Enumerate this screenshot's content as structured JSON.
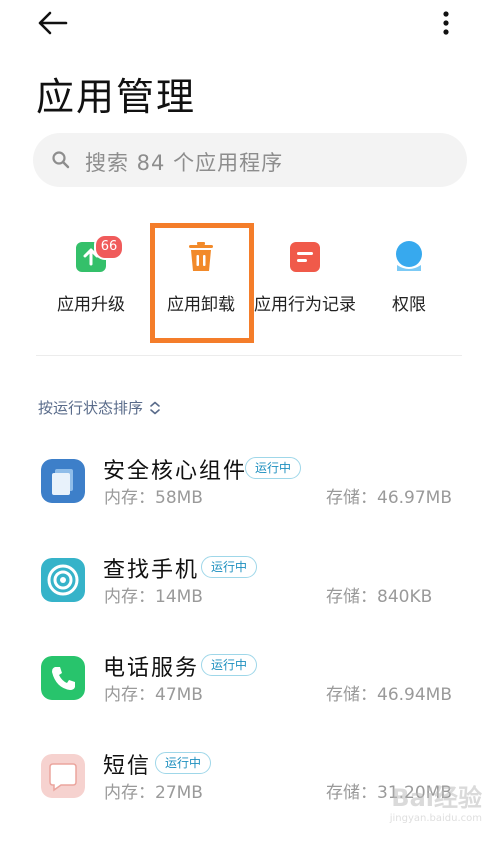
{
  "header": {
    "title": "应用管理"
  },
  "search": {
    "placeholder": "搜索 84 个应用程序"
  },
  "quick_actions": [
    {
      "label": "应用升级",
      "icon": "upgrade-icon",
      "badge": "66",
      "color": "#34c06a"
    },
    {
      "label": "应用卸载",
      "icon": "trash-icon",
      "color": "#f28a2a",
      "highlighted": true
    },
    {
      "label": "应用行为记录",
      "icon": "record-icon",
      "color": "#f05a4a"
    },
    {
      "label": "权限",
      "icon": "permission-icon",
      "color": "#37a9ee"
    }
  ],
  "sort": {
    "label": "按运行状态排序"
  },
  "apps": [
    {
      "name": "安全核心组件",
      "status": "运行中",
      "memory": "内存：58MB",
      "storage": "存储：46.97MB",
      "icon": "security-core-icon",
      "color": "#3d7fc9"
    },
    {
      "name": "查找手机",
      "status": "运行中",
      "memory": "内存：14MB",
      "storage": "存储：840KB",
      "icon": "find-phone-icon",
      "color": "#36b3c9"
    },
    {
      "name": "电话服务",
      "status": "运行中",
      "memory": "内存：47MB",
      "storage": "存储：46.94MB",
      "icon": "phone-icon",
      "color": "#28c46c"
    },
    {
      "name": "短信",
      "status": "运行中",
      "memory": "内存：27MB",
      "storage": "存储：31.20MB",
      "icon": "message-icon",
      "color": "#f2b6b0"
    }
  ],
  "watermark": {
    "text": "Bai经验",
    "url_text": "jingyan.baidu.com"
  },
  "colors": {
    "highlight": "#f47d2a",
    "status_text": "#1d8fbf",
    "status_border": "#9fd7e9"
  }
}
